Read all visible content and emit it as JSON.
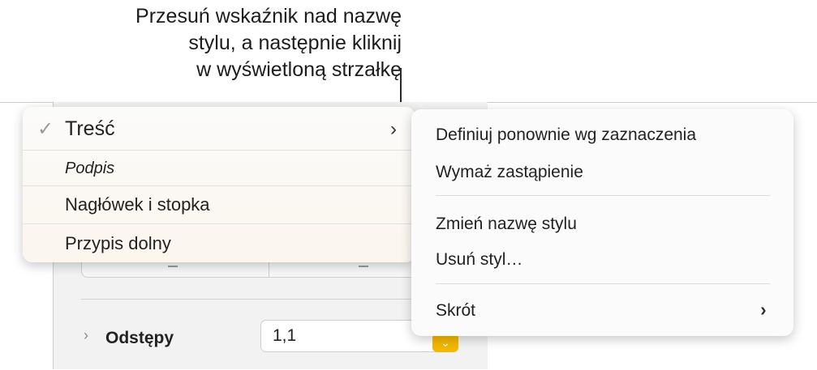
{
  "callout": {
    "lines": [
      "Przesuń wskaźnik nad nazwę",
      "stylu, a następnie kliknij",
      "w wyświetloną strzałkę"
    ]
  },
  "style_menu": {
    "items": [
      {
        "label": "Treść",
        "checked": true,
        "has_arrow": true,
        "style": "large"
      },
      {
        "label": "Podpis",
        "checked": false,
        "has_arrow": false,
        "style": "italic"
      },
      {
        "label": "Nagłówek i stopka",
        "checked": false,
        "has_arrow": false,
        "style": "normal"
      },
      {
        "label": "Przypis dolny",
        "checked": false,
        "has_arrow": false,
        "style": "normal"
      }
    ]
  },
  "context_menu": {
    "items": [
      {
        "label": "Definiuj ponownie wg zaznaczenia"
      },
      {
        "label": "Wymaż zastąpienie"
      },
      {
        "label": "Zmień nazwę stylu"
      },
      {
        "label": "Usuń styl…"
      },
      {
        "label": "Skrót",
        "has_submenu": true
      }
    ]
  },
  "inspector": {
    "spacing_label": "Odstępy",
    "spacing_value": "1,1"
  },
  "colors": {
    "accent": "#f5b800"
  }
}
